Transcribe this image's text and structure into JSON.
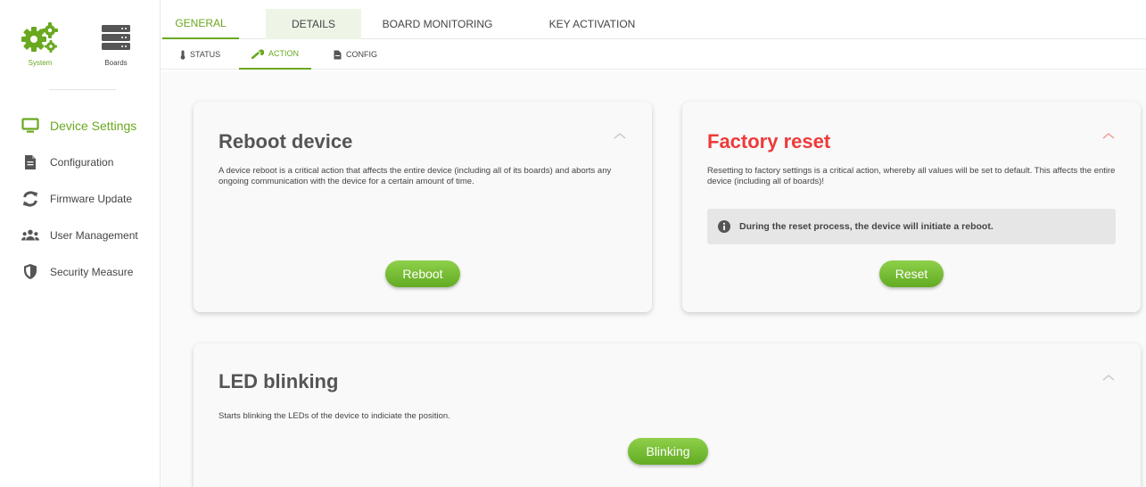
{
  "sidebar": {
    "top": {
      "system_label": "System",
      "boards_label": "Boards"
    },
    "items": [
      {
        "label": "Device Settings",
        "icon": "monitor-icon"
      },
      {
        "label": "Configuration",
        "icon": "document-icon"
      },
      {
        "label": "Firmware Update",
        "icon": "refresh-icon"
      },
      {
        "label": "User Management",
        "icon": "users-icon"
      },
      {
        "label": "Security Measure",
        "icon": "shield-icon"
      }
    ]
  },
  "tabs": [
    "GENERAL",
    "DETAILS",
    "BOARD MONITORING",
    "KEY ACTIVATION"
  ],
  "subtabs": [
    "STATUS",
    "ACTION",
    "CONFIG"
  ],
  "cards": {
    "reboot": {
      "title": "Reboot device",
      "description": "A device reboot is a critical action that affects the entire device (including all of its boards) and aborts any ongoing communication with the device for a certain amount of time.",
      "button": "Reboot"
    },
    "reset": {
      "title": "Factory reset",
      "description": "Resetting to factory settings is a critical action, whereby all values will be set to default. This affects the entire device (including all of boards)!",
      "info": "During the reset process, the device will initiate a reboot.",
      "button": "Reset"
    },
    "led": {
      "title": "LED blinking",
      "description": "Starts blinking the LEDs of the device to indiciate the position.",
      "button": "Blinking"
    }
  },
  "colors": {
    "accent": "#6aa820",
    "danger": "#ee3a3a"
  }
}
